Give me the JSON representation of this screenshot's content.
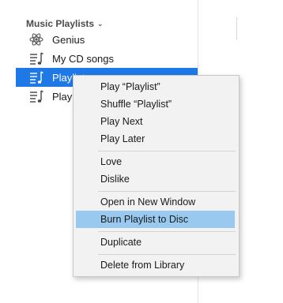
{
  "sidebar": {
    "section_title": "Music Playlists",
    "items": [
      {
        "label": "Genius",
        "icon": "genius-atom-icon"
      },
      {
        "label": "My CD songs",
        "icon": "playlist-icon"
      },
      {
        "label": "Playlist",
        "icon": "playlist-icon",
        "selected": true
      },
      {
        "label": "Playlist",
        "icon": "playlist-icon"
      }
    ]
  },
  "context_menu": {
    "items": [
      "Play “Playlist”",
      "Shuffle “Playlist”",
      "Play Next",
      "Play Later",
      "Love",
      "Dislike",
      "Open in New Window",
      "Burn Playlist to Disc",
      "Duplicate",
      "Delete from Library"
    ],
    "highlighted": "Burn Playlist to Disc"
  },
  "colors": {
    "selection": "#1e78e6",
    "menu_highlight": "#99c9ef",
    "menu_background": "#f2f2f2"
  }
}
